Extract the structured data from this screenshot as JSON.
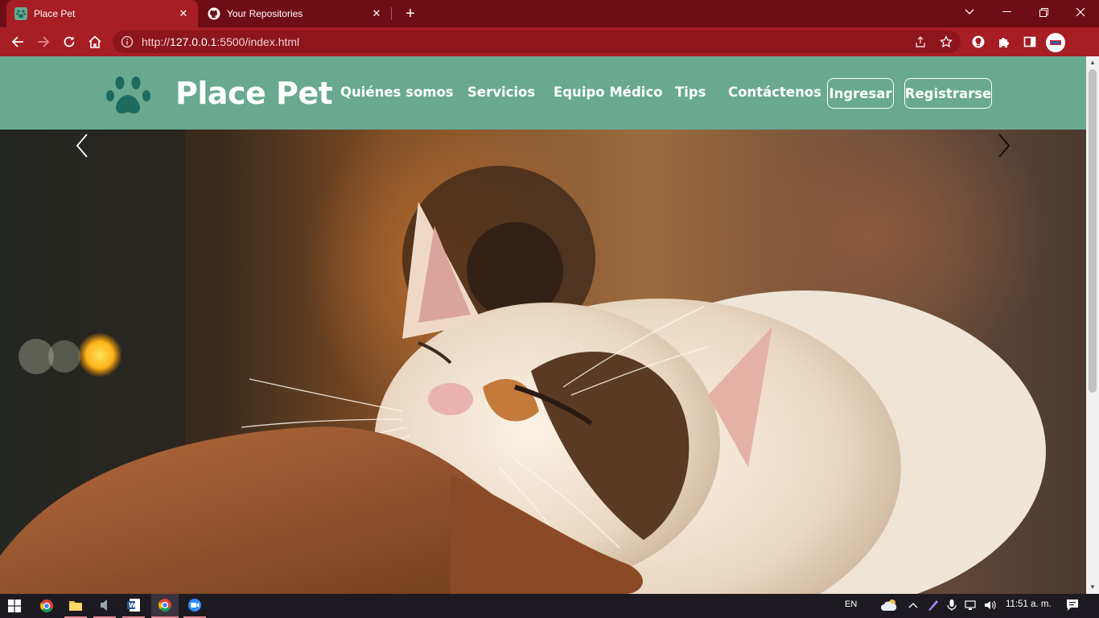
{
  "browser": {
    "tabs": [
      {
        "title": "Place Pet",
        "active": true,
        "favicon": "paw-favicon"
      },
      {
        "title": "Your Repositories",
        "active": false,
        "favicon": "github-icon"
      }
    ],
    "address": {
      "prefix": "http://",
      "host": "127.0.0.1",
      "rest": ":5500/index.html"
    }
  },
  "site": {
    "brand": "Place Pet",
    "nav": [
      "Quiénes somos",
      "Servicios",
      "Equipo Médico",
      "Tips",
      "Contáctenos"
    ],
    "login_label": "Ingresar",
    "register_label": "Registrarse"
  },
  "hero": {
    "image": "sleeping-calico-cat-photo"
  },
  "taskbar": {
    "language": "EN",
    "time": "11:51 a. m."
  },
  "colors": {
    "tab_strip": "#6f0d14",
    "toolbar": "#a61d24",
    "site_header": "#68a990",
    "logo_paw": "#1c6b5e",
    "taskbar": "#1e1a22"
  }
}
